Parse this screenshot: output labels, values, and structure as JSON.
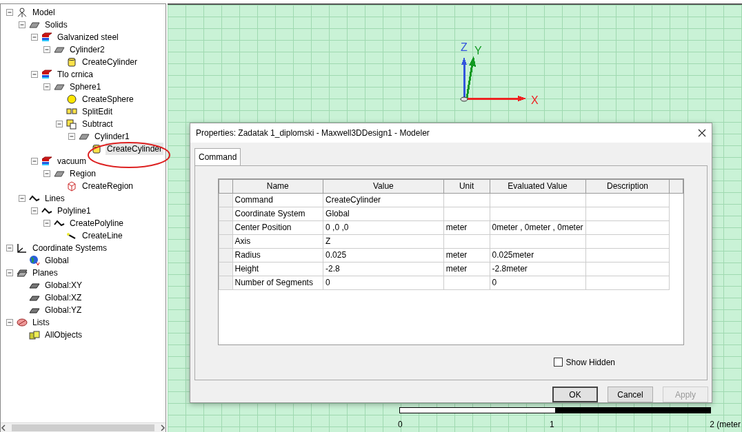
{
  "tree": [
    {
      "label": "Model",
      "kind": "model",
      "expanded": true,
      "selected": false,
      "children": [
        {
          "label": "Solids",
          "kind": "object",
          "expanded": true,
          "selected": false,
          "children": [
            {
              "label": "Galvanized steel",
              "kind": "material",
              "expanded": true,
              "selected": false,
              "children": [
                {
                  "label": "Cylinder2",
                  "kind": "object",
                  "expanded": true,
                  "selected": false,
                  "children": [
                    {
                      "label": "CreateCylinder",
                      "kind": "cylinder",
                      "selected": false
                    }
                  ]
                }
              ]
            },
            {
              "label": "Tlo crnica",
              "kind": "material",
              "expanded": true,
              "selected": false,
              "children": [
                {
                  "label": "Sphere1",
                  "kind": "object",
                  "expanded": true,
                  "selected": false,
                  "children": [
                    {
                      "label": "CreateSphere",
                      "kind": "sphere",
                      "selected": false
                    },
                    {
                      "label": "SplitEdit",
                      "kind": "split",
                      "selected": false
                    },
                    {
                      "label": "Subtract",
                      "kind": "subtract",
                      "expanded": true,
                      "selected": false,
                      "children": [
                        {
                          "label": "Cylinder1",
                          "kind": "object",
                          "expanded": true,
                          "selected": false,
                          "children": [
                            {
                              "label": "CreateCylinder",
                              "kind": "cylinder",
                              "selected": true
                            }
                          ]
                        }
                      ]
                    }
                  ]
                }
              ]
            },
            {
              "label": "vacuum",
              "kind": "material",
              "expanded": true,
              "selected": false,
              "children": [
                {
                  "label": "Region",
                  "kind": "object",
                  "expanded": true,
                  "selected": false,
                  "children": [
                    {
                      "label": "CreateRegion",
                      "kind": "region",
                      "selected": false
                    }
                  ]
                }
              ]
            }
          ]
        },
        {
          "label": "Lines",
          "kind": "line",
          "expanded": true,
          "selected": false,
          "children": [
            {
              "label": "Polyline1",
              "kind": "line",
              "expanded": true,
              "selected": false,
              "children": [
                {
                  "label": "CreatePolyline",
                  "kind": "line",
                  "expanded": true,
                  "selected": false,
                  "children": [
                    {
                      "label": "CreateLine",
                      "kind": "segment",
                      "selected": false
                    }
                  ]
                }
              ]
            }
          ]
        }
      ]
    },
    {
      "label": "Coordinate Systems",
      "kind": "coordsys",
      "expanded": true,
      "selected": false,
      "children": [
        {
          "label": "Global",
          "kind": "globe",
          "selected": false
        }
      ]
    },
    {
      "label": "Planes",
      "kind": "planes",
      "expanded": true,
      "selected": false,
      "children": [
        {
          "label": "Global:XY",
          "kind": "plane",
          "selected": false
        },
        {
          "label": "Global:XZ",
          "kind": "plane",
          "selected": false
        },
        {
          "label": "Global:YZ",
          "kind": "plane",
          "selected": false
        }
      ]
    },
    {
      "label": "Lists",
      "kind": "lists",
      "expanded": true,
      "selected": false,
      "children": [
        {
          "label": "AllObjects",
          "kind": "allobjects",
          "selected": false
        }
      ]
    }
  ],
  "viewport": {
    "axes": [
      {
        "label": "Z",
        "color": "#3355dd"
      },
      {
        "label": "Y",
        "color": "#119922"
      },
      {
        "label": "X",
        "color": "#ee2222"
      }
    ],
    "scale_labels": [
      "0",
      "1",
      "2 (meter"
    ]
  },
  "dialog": {
    "title": "Properties: Zadatak 1_diplomski - Maxwell3DDesign1 - Modeler",
    "tabs": [
      {
        "label": "Command",
        "selected": true
      }
    ],
    "columns": [
      "Name",
      "Value",
      "Unit",
      "Evaluated Value",
      "Description"
    ],
    "rows": [
      {
        "name": "Command",
        "value": "CreateCylinder"
      },
      {
        "name": "Coordinate System",
        "value": "Global"
      },
      {
        "name": "Center Position",
        "value": "0 ,0 ,0",
        "unit": "meter",
        "evaluated_value": "0meter , 0meter , 0meter"
      },
      {
        "name": "Axis",
        "value": "Z"
      },
      {
        "name": "Radius",
        "value": "0.025",
        "unit": "meter",
        "evaluated_value": "0.025meter"
      },
      {
        "name": "Height",
        "value": "-2.8",
        "unit": "meter",
        "evaluated_value": "-2.8meter"
      },
      {
        "name": "Number of Segments",
        "value": "0",
        "evaluated_value": "0"
      }
    ],
    "show_hidden": {
      "label": "Show Hidden",
      "checked": false
    },
    "buttons": [
      {
        "label": "OK",
        "default": true,
        "disabled": false
      },
      {
        "label": "Cancel",
        "default": false,
        "disabled": false
      },
      {
        "label": "Apply",
        "default": false,
        "disabled": true
      }
    ]
  }
}
